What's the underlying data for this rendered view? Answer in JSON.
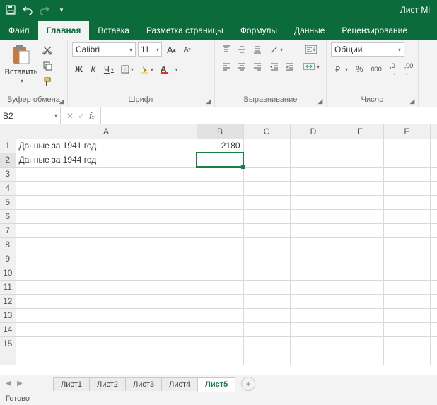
{
  "title": "Лист Mi",
  "tabs": {
    "file": "Файл",
    "home": "Главная",
    "insert": "Вставка",
    "layout": "Разметка страницы",
    "formulas": "Формулы",
    "data": "Данные",
    "review": "Рецензирование"
  },
  "ribbon": {
    "clipboard": {
      "label": "Буфер обмена",
      "paste": "Вставить"
    },
    "font": {
      "label": "Шрифт",
      "name": "Calibri",
      "size": "11",
      "bold": "Ж",
      "italic": "К",
      "underline": "Ч"
    },
    "align": {
      "label": "Выравнивание"
    },
    "number": {
      "label": "Число",
      "format": "Общий"
    }
  },
  "namebox": "B2",
  "formula": "",
  "columns": [
    "A",
    "B",
    "C",
    "D",
    "E",
    "F"
  ],
  "rows": [
    "1",
    "2",
    "3",
    "4",
    "5",
    "6",
    "7",
    "8",
    "9",
    "10",
    "11",
    "12",
    "13",
    "14",
    "15"
  ],
  "cells": {
    "A1": "Данные за 1941 год",
    "B1": "2180",
    "A2": "Данные за 1944 год"
  },
  "sheets": {
    "s1": "Лист1",
    "s2": "Лист2",
    "s3": "Лист3",
    "s4": "Лист4",
    "s5": "Лист5"
  },
  "status": "Готово"
}
